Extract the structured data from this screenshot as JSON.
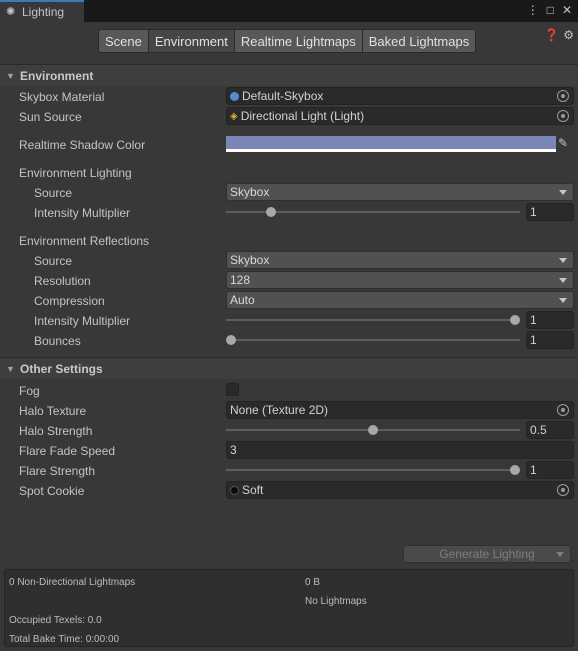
{
  "window": {
    "tab_title": "Lighting",
    "tab_icon": "lightbulb-icon",
    "controls": {
      "menu": "⋮",
      "maximize": "□",
      "close": "✕"
    }
  },
  "subtabs": [
    "Scene",
    "Environment",
    "Realtime Lightmaps",
    "Baked Lightmaps"
  ],
  "active_subtab": "Environment",
  "environment": {
    "header": "Environment",
    "skybox_material": {
      "label": "Skybox Material",
      "value": "Default-Skybox"
    },
    "sun_source": {
      "label": "Sun Source",
      "value": "Directional Light (Light)"
    },
    "shadow_color": {
      "label": "Realtime Shadow Color",
      "color": "#7a86b5"
    },
    "env_lighting": {
      "label": "Environment Lighting",
      "source_label": "Source",
      "source_value": "Skybox",
      "intensity_label": "Intensity Multiplier",
      "intensity_value": "1",
      "intensity_fraction": 0.14
    },
    "env_reflections": {
      "label": "Environment Reflections",
      "source_label": "Source",
      "source_value": "Skybox",
      "resolution_label": "Resolution",
      "resolution_value": "128",
      "compression_label": "Compression",
      "compression_value": "Auto",
      "intensity_label": "Intensity Multiplier",
      "intensity_value": "1",
      "intensity_fraction": 1.0,
      "bounces_label": "Bounces",
      "bounces_value": "1",
      "bounces_fraction": 0.0
    }
  },
  "other": {
    "header": "Other Settings",
    "fog_label": "Fog",
    "halo_texture_label": "Halo Texture",
    "halo_texture_value": "None (Texture 2D)",
    "halo_strength_label": "Halo Strength",
    "halo_strength_value": "0.5",
    "halo_strength_fraction": 0.5,
    "flare_fade_label": "Flare Fade Speed",
    "flare_fade_value": "3",
    "flare_strength_label": "Flare Strength",
    "flare_strength_value": "1",
    "flare_strength_fraction": 1.0,
    "spot_cookie_label": "Spot Cookie",
    "spot_cookie_value": "Soft"
  },
  "generate_button": "Generate Lighting",
  "stats": {
    "lightmaps": "0 Non-Directional Lightmaps",
    "size": "0 B",
    "no_lightmaps": "No Lightmaps",
    "texels": "Occupied Texels: 0.0",
    "bake_time": "Total Bake Time: 0:00:00"
  }
}
